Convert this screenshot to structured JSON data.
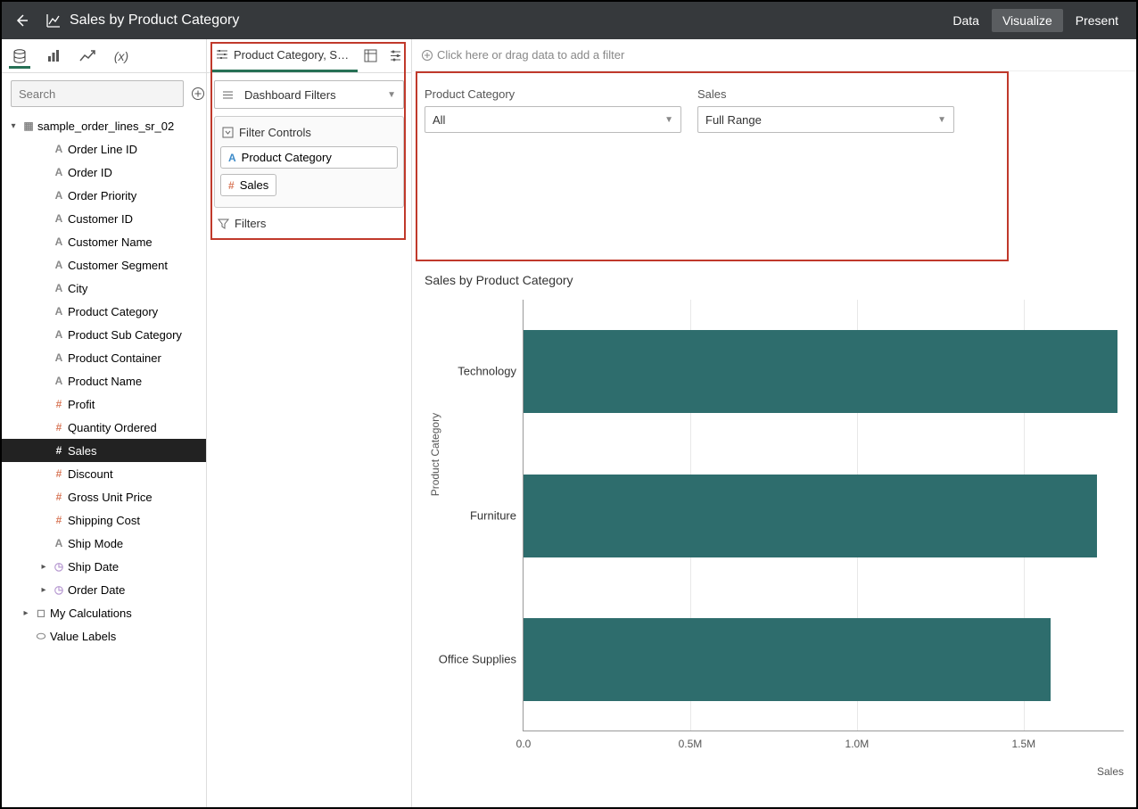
{
  "header": {
    "title": "Sales by Product Category",
    "tabs": {
      "data": "Data",
      "visualize": "Visualize",
      "present": "Present"
    }
  },
  "left": {
    "search_placeholder": "Search",
    "dataset": "sample_order_lines_sr_02",
    "fields": [
      {
        "icon": "a",
        "label": "Order Line ID"
      },
      {
        "icon": "a",
        "label": "Order ID"
      },
      {
        "icon": "a",
        "label": "Order Priority"
      },
      {
        "icon": "a",
        "label": "Customer ID"
      },
      {
        "icon": "a",
        "label": "Customer Name"
      },
      {
        "icon": "a",
        "label": "Customer Segment"
      },
      {
        "icon": "a",
        "label": "City"
      },
      {
        "icon": "a",
        "label": "Product Category"
      },
      {
        "icon": "a",
        "label": "Product Sub Category"
      },
      {
        "icon": "a",
        "label": "Product Container"
      },
      {
        "icon": "a",
        "label": "Product Name"
      },
      {
        "icon": "hash",
        "label": "Profit"
      },
      {
        "icon": "hash",
        "label": "Quantity Ordered"
      },
      {
        "icon": "hash",
        "label": "Sales",
        "selected": true
      },
      {
        "icon": "hash",
        "label": "Discount"
      },
      {
        "icon": "hash",
        "label": "Gross Unit Price"
      },
      {
        "icon": "hash",
        "label": "Shipping Cost"
      },
      {
        "icon": "a",
        "label": "Ship Mode"
      },
      {
        "icon": "clock",
        "label": "Ship Date",
        "caret": true
      },
      {
        "icon": "clock",
        "label": "Order Date",
        "caret": true
      }
    ],
    "my_calculations": "My Calculations",
    "value_labels": "Value Labels"
  },
  "mid": {
    "tab_label": "Product Category, S…",
    "dashboard_filters": "Dashboard Filters",
    "filter_controls": "Filter Controls",
    "chips": {
      "product_category": "Product Category",
      "sales": "Sales"
    },
    "filters": "Filters"
  },
  "right": {
    "filter_hint": "Click here or drag data to add a filter",
    "pc_label": "Product Category",
    "pc_value": "All",
    "sales_label": "Sales",
    "sales_value": "Full Range"
  },
  "chart_data": {
    "type": "bar",
    "orientation": "horizontal",
    "title": "Sales by Product Category",
    "ylabel": "Product Category",
    "xlabel": "Sales",
    "categories": [
      "Technology",
      "Furniture",
      "Office Supplies"
    ],
    "values": [
      1780000,
      1720000,
      1580000
    ],
    "x_ticks": [
      0,
      500000,
      1000000,
      1500000
    ],
    "x_tick_labels": [
      "0.0",
      "0.5M",
      "1.0M",
      "1.5M"
    ],
    "xlim": [
      0,
      1800000
    ],
    "bar_color": "#2e6d6d"
  }
}
